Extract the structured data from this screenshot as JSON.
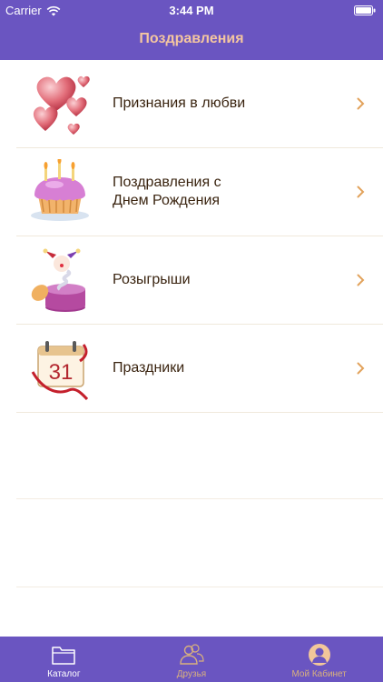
{
  "status_bar": {
    "carrier": "Carrier",
    "time": "3:44 PM"
  },
  "nav": {
    "title": "Поздравления"
  },
  "list": {
    "items": [
      {
        "label": "Признания в любви",
        "icon": "hearts-icon"
      },
      {
        "label": "Поздравления с\nДнем Рождения",
        "icon": "birthday-cake-icon"
      },
      {
        "label": "Розыгрыши",
        "icon": "jack-in-the-box-icon"
      },
      {
        "label": "Праздники",
        "icon": "calendar-icon",
        "icon_text": "31"
      }
    ]
  },
  "tabbar": {
    "items": [
      {
        "label": "Каталог",
        "icon": "folder-icon",
        "active": true
      },
      {
        "label": "Друзья",
        "icon": "friends-icon",
        "active": false
      },
      {
        "label": "Мой Кабинет",
        "icon": "profile-icon",
        "active": false
      }
    ]
  },
  "colors": {
    "bar": "#6a55c1",
    "title": "#f4c6a0",
    "chevron": "#e2a25b",
    "inactive_tab": "#d9b17d",
    "separator": "#f0e9dc"
  }
}
